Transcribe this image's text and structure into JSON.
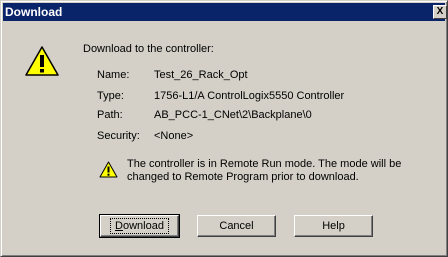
{
  "window": {
    "title": "Download",
    "close_glyph": "X"
  },
  "icons": {
    "main": "warning-icon",
    "notice": "warning-icon"
  },
  "heading": "Download to the controller:",
  "fields": [
    {
      "label": "Name:",
      "value": "Test_26_Rack_Opt"
    },
    {
      "label": "Type:",
      "value": "1756-L1/A ControlLogix5550 Controller"
    },
    {
      "label": "Path:",
      "value": "AB_PCC-1_CNet\\2\\Backplane\\0"
    },
    {
      "label": "Security:",
      "value": "<None>"
    }
  ],
  "warning": "The controller is in Remote Run mode. The mode will be changed to Remote Program prior to download.",
  "buttons": {
    "download": {
      "accel": "D",
      "rest": "ownload"
    },
    "cancel": "Cancel",
    "help": "Help"
  },
  "colors": {
    "title_bar": "#0a246a",
    "dialog_face": "#d4d0c8",
    "warning_yellow": "#ffff00"
  }
}
